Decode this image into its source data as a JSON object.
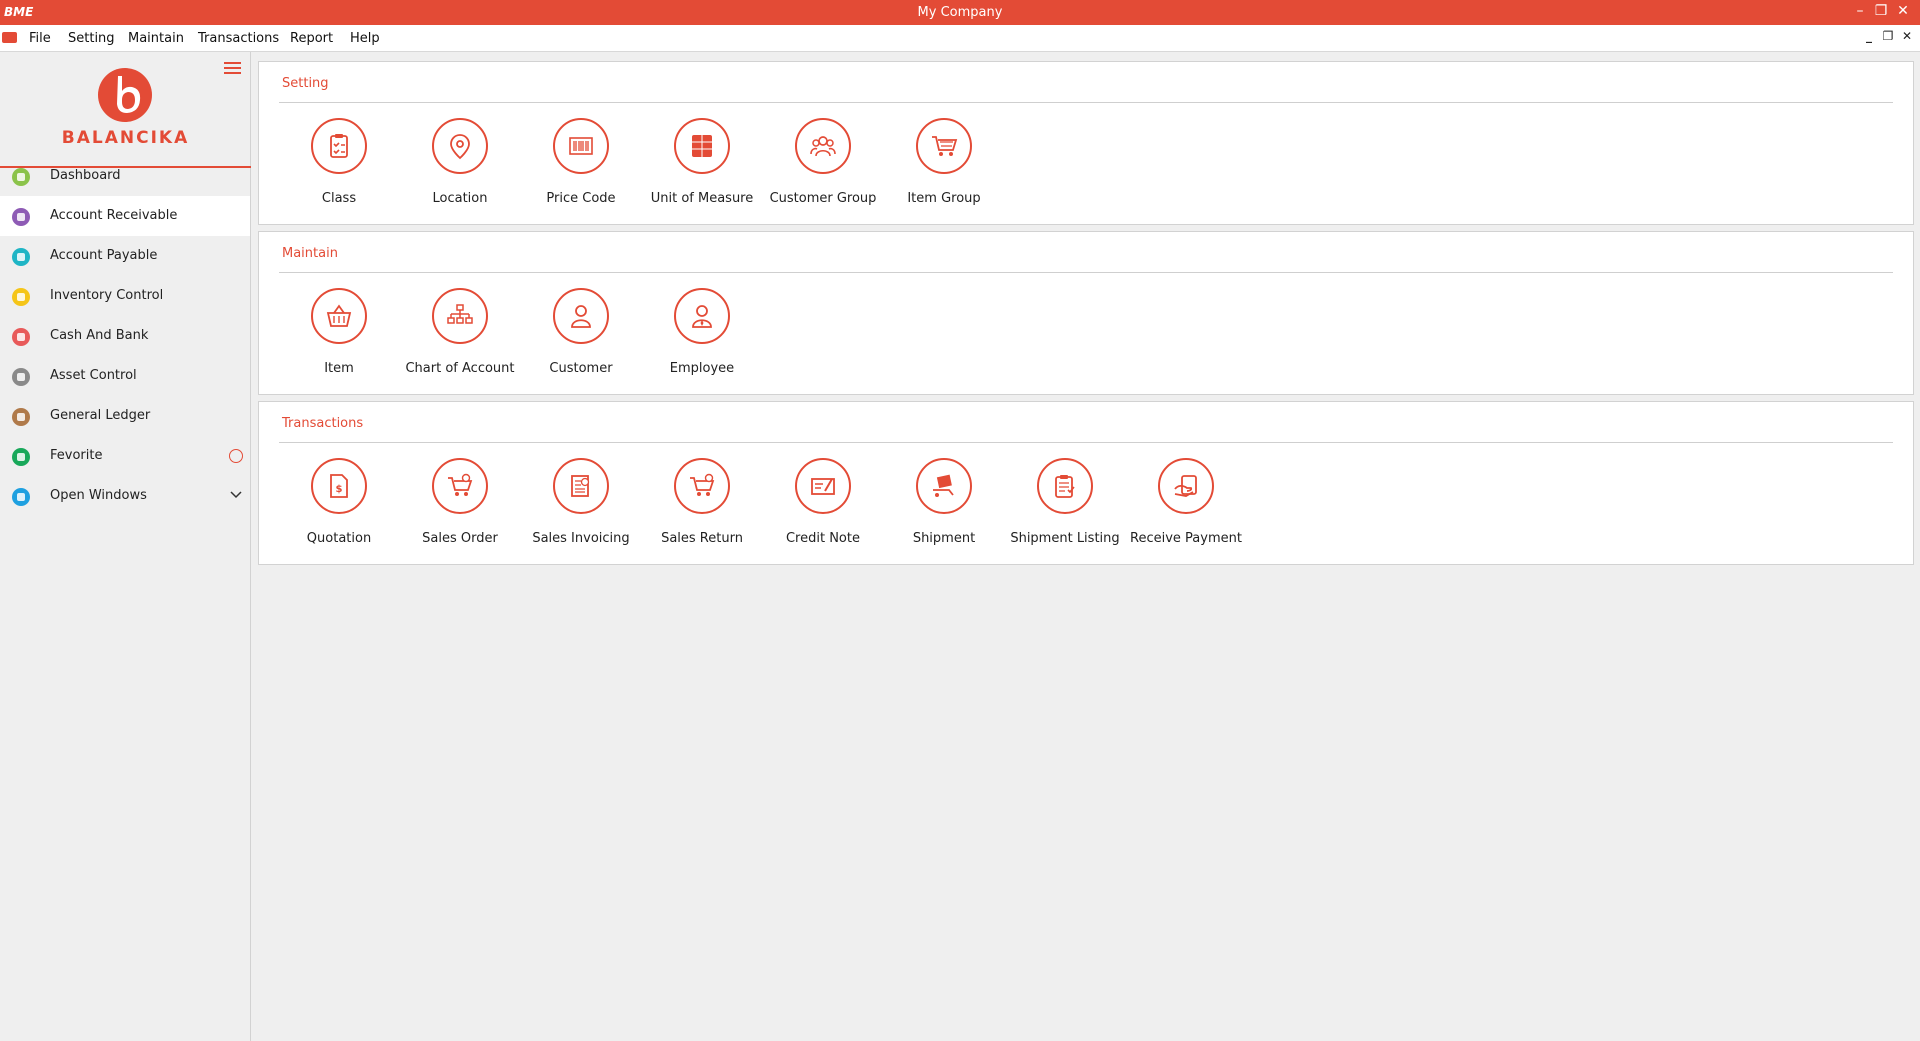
{
  "window": {
    "app_logo": "BME",
    "title": "My Company"
  },
  "menu": {
    "items": [
      "File",
      "Setting",
      "Maintain",
      "Transactions",
      "Report",
      "Help"
    ]
  },
  "sidebar": {
    "brand": "BALANCIKA",
    "items": [
      {
        "label": "Dashboard",
        "icon": "dashboard-icon",
        "color": "#8bc34a"
      },
      {
        "label": "Account Receivable",
        "icon": "account-receivable-icon",
        "color": "#8e5bb5"
      },
      {
        "label": "Account Payable",
        "icon": "account-payable-icon",
        "color": "#1fb5c5"
      },
      {
        "label": "Inventory Control",
        "icon": "inventory-icon",
        "color": "#f5c518"
      },
      {
        "label": "Cash And Bank",
        "icon": "cash-bank-icon",
        "color": "#e85a5a"
      },
      {
        "label": "Asset Control",
        "icon": "asset-clock-icon",
        "color": "#8a8a8a"
      },
      {
        "label": "General Ledger",
        "icon": "ledger-icon",
        "color": "#b07a4a"
      },
      {
        "label": "Fevorite",
        "icon": "star-icon",
        "color": "#18a85a"
      },
      {
        "label": "Open Windows",
        "icon": "windows-icon",
        "color": "#1ea0e0"
      }
    ]
  },
  "sections": {
    "setting": {
      "title": "Setting",
      "tiles": [
        "Class",
        "Location",
        "Price Code",
        "Unit of Measure",
        "Customer Group",
        "Item Group"
      ]
    },
    "maintain": {
      "title": "Maintain",
      "tiles": [
        "Item",
        "Chart of Account",
        "Customer",
        "Employee"
      ]
    },
    "transactions": {
      "title": "Transactions",
      "tiles": [
        "Quotation",
        "Sales Order",
        "Sales Invoicing",
        "Sales Return",
        "Credit Note",
        "Shipment",
        "Shipment Listing",
        "Receive Payment"
      ]
    }
  },
  "colors": {
    "accent": "#e34b36"
  }
}
